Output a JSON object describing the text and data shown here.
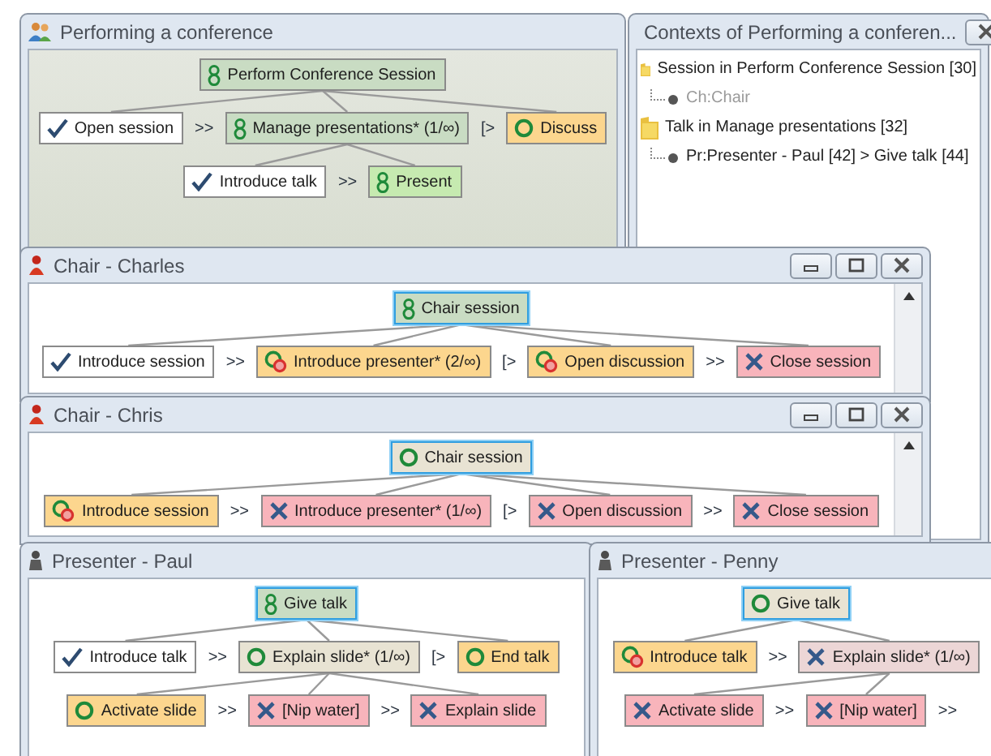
{
  "windows": [
    {
      "kind": "process",
      "title": "Performing a conference",
      "tree": {
        "text": "Perform Conference Session",
        "kind": "group",
        "color": "#c9dcc3",
        "focused": false,
        "children": [
          {
            "text": "Open session",
            "kind": "done",
            "color": "#ffffff",
            "focused": false,
            "next_op": ">>"
          },
          {
            "text": "Manage presentations* (1/∞)",
            "kind": "group",
            "color": "#c9dcc3",
            "focused": false,
            "next_op": "[>",
            "children": [
              {
                "text": "Introduce talk",
                "kind": "done",
                "color": "#ffffff",
                "focused": false,
                "next_op": ">>"
              },
              {
                "text": "Present",
                "kind": "group",
                "color": "#c6eab0",
                "focused": false
              }
            ]
          },
          {
            "text": "Discuss",
            "kind": "enabled",
            "color": "#fcd68e",
            "focused": false
          }
        ]
      }
    },
    {
      "kind": "contexts",
      "title": "Contexts of Performing a conferen...",
      "items": [
        {
          "text": "Session in Perform Conference Session [30]",
          "children": [
            {
              "text": "Ch:Chair",
              "active": false
            }
          ]
        },
        {
          "text": "Talk in Manage presentations [32]",
          "children": [
            {
              "text": "Pr:Presenter - Paul [42] > Give talk [44]",
              "active": true
            }
          ]
        }
      ]
    },
    {
      "kind": "chair",
      "title": "Chair - Charles",
      "tree": {
        "text": "Chair session",
        "kind": "group",
        "color": "#c9dcc3",
        "focused": true,
        "children": [
          {
            "text": "Introduce session",
            "kind": "done",
            "color": "#ffffff",
            "focused": false,
            "next_op": ">>"
          },
          {
            "text": "Introduce presenter* (2/∞)",
            "kind": "busy",
            "color": "#fcd68e",
            "focused": false,
            "next_op": "[>"
          },
          {
            "text": "Open discussion",
            "kind": "busy",
            "color": "#fcd68e",
            "focused": false,
            "next_op": ">>"
          },
          {
            "text": "Close session",
            "kind": "disabled",
            "color": "#f8b4bb",
            "focused": false
          }
        ]
      }
    },
    {
      "kind": "chair",
      "title": "Chair - Chris",
      "tree": {
        "text": "Chair session",
        "kind": "enabled",
        "color": "#e8e3d3",
        "focused": true,
        "children": [
          {
            "text": "Introduce session",
            "kind": "busy",
            "color": "#fcd68e",
            "focused": false,
            "next_op": ">>"
          },
          {
            "text": "Introduce presenter* (1/∞)",
            "kind": "disabled",
            "color": "#f8b4bb",
            "focused": false,
            "next_op": "[>"
          },
          {
            "text": "Open discussion",
            "kind": "disabled",
            "color": "#f8b4bb",
            "focused": false,
            "next_op": ">>"
          },
          {
            "text": "Close session",
            "kind": "disabled",
            "color": "#f8b4bb",
            "focused": false
          }
        ]
      }
    },
    {
      "kind": "presenter",
      "title": "Presenter - Paul",
      "tree": {
        "text": "Give talk",
        "kind": "group",
        "color": "#c9dcc3",
        "focused": true,
        "children": [
          {
            "text": "Introduce talk",
            "kind": "done",
            "color": "#ffffff",
            "focused": false,
            "next_op": ">>"
          },
          {
            "text": "Explain slide* (1/∞)",
            "kind": "enabled",
            "color": "#e8e3d3",
            "focused": false,
            "next_op": "[>",
            "children": [
              {
                "text": "Activate slide",
                "kind": "enabled",
                "color": "#fcd68e",
                "focused": false,
                "next_op": ">>"
              },
              {
                "text": "[Nip water]",
                "kind": "disabled",
                "color": "#f8b4bb",
                "focused": false,
                "next_op": ">>"
              },
              {
                "text": "Explain slide",
                "kind": "disabled",
                "color": "#f8b4bb",
                "focused": false
              }
            ]
          },
          {
            "text": "End talk",
            "kind": "enabled",
            "color": "#fcd68e",
            "focused": false
          }
        ]
      }
    },
    {
      "kind": "presenter",
      "title": "Presenter - Penny",
      "tree": {
        "text": "Give talk",
        "kind": "enabled",
        "color": "#e8e3d3",
        "focused": true,
        "children": [
          {
            "text": "Introduce talk",
            "kind": "busy",
            "color": "#fcd68e",
            "focused": false,
            "next_op": ">>"
          },
          {
            "text": "Explain slide* (1/∞)",
            "kind": "disabled",
            "color": "#ecd6d6",
            "focused": false,
            "children": [
              {
                "text": "Activate slide",
                "kind": "disabled",
                "color": "#f8b4bb",
                "focused": false,
                "next_op": ">>"
              },
              {
                "text": "[Nip water]",
                "kind": "disabled",
                "color": "#f8b4bb",
                "focused": false,
                "next_op": ">>"
              }
            ]
          }
        ]
      }
    }
  ]
}
